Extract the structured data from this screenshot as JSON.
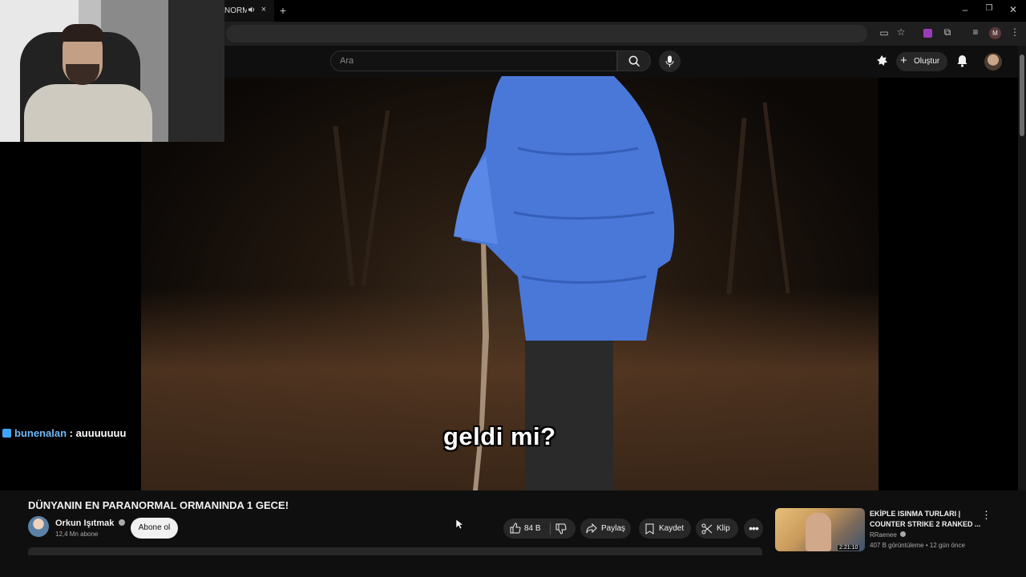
{
  "browser": {
    "tab_title": "NORM",
    "tab_audio_icon": "speaker-icon",
    "new_tab_symbol": "+",
    "close_symbol": "×",
    "profile_letter": "M"
  },
  "header": {
    "search_placeholder": "Ara",
    "create_label": "Oluştur"
  },
  "overlay": {
    "subtitle": "geldi mi?",
    "chat_user": "bunenalan",
    "chat_message": ": auuuuuuu"
  },
  "video": {
    "title": "DÜNYANIN EN PARANORMAL ORMANINDA 1 GECE!",
    "channel_name": "Orkun Işıtmak",
    "channel_subs": "12,4 Mn abone",
    "subscribe_label": "Abone ol",
    "like_count": "84 B",
    "share_label": "Paylaş",
    "save_label": "Kaydet",
    "clip_label": "Klip"
  },
  "recommended": {
    "title": "EKİPLE ISINMA TURLARI | COUNTER STRIKE 2 RANKED ...",
    "channel": "RRaenee",
    "meta": "407 B görüntüleme • 12 gün önce",
    "duration": "2:21:10"
  },
  "colors": {
    "background": "#0f0f0f",
    "jacket": "#4a78d9",
    "chat_user": "#6fb8f7",
    "badge": "#c4161c"
  }
}
